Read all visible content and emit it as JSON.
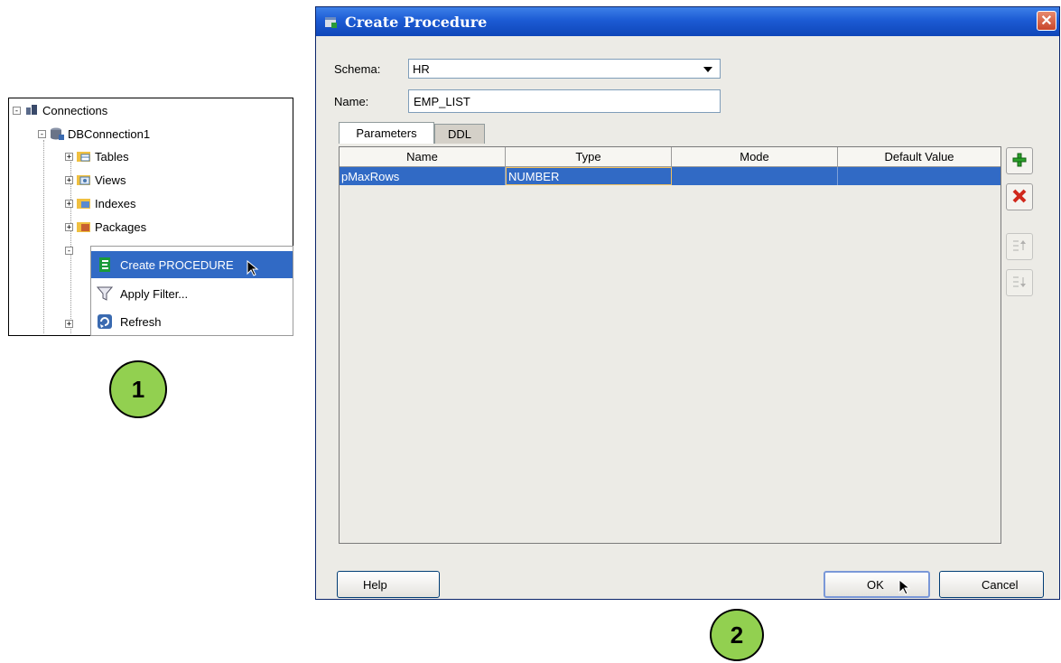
{
  "tree": {
    "connections": "Connections",
    "connection": "DBConnection1",
    "nodes": [
      "Tables",
      "Views",
      "Indexes",
      "Packages"
    ],
    "expand_glyph": "+",
    "collapse_glyph": "-"
  },
  "context_menu": {
    "items": [
      {
        "label": "Create PROCEDURE",
        "icon": "procedure-icon",
        "selected": true
      },
      {
        "label": "Apply Filter...",
        "icon": "filter-icon",
        "selected": false
      },
      {
        "label": "Refresh",
        "icon": "refresh-icon",
        "selected": false
      }
    ]
  },
  "steps": [
    "1",
    "2"
  ],
  "dialog": {
    "title": "Create Procedure",
    "close_glyph": "✕",
    "schema_label": "Schema:",
    "schema_value": "HR",
    "name_label": "Name:",
    "name_value": "EMP_LIST",
    "tabs": [
      "Parameters",
      "DDL"
    ],
    "columns": [
      "Name",
      "Type",
      "Mode",
      "Default Value"
    ],
    "rows": [
      {
        "name": "pMaxRows",
        "type": "NUMBER",
        "mode": "",
        "default": ""
      }
    ],
    "side_buttons": [
      "add-icon",
      "remove-icon",
      "move-up-icon",
      "move-down-icon"
    ],
    "buttons": {
      "help": "Help",
      "ok": "OK",
      "cancel": "Cancel"
    }
  },
  "colors": {
    "selection": "#316ac5",
    "titlebar": "#1c5bd4",
    "badge": "#92d050",
    "dialog_bg": "#ecebe6"
  }
}
